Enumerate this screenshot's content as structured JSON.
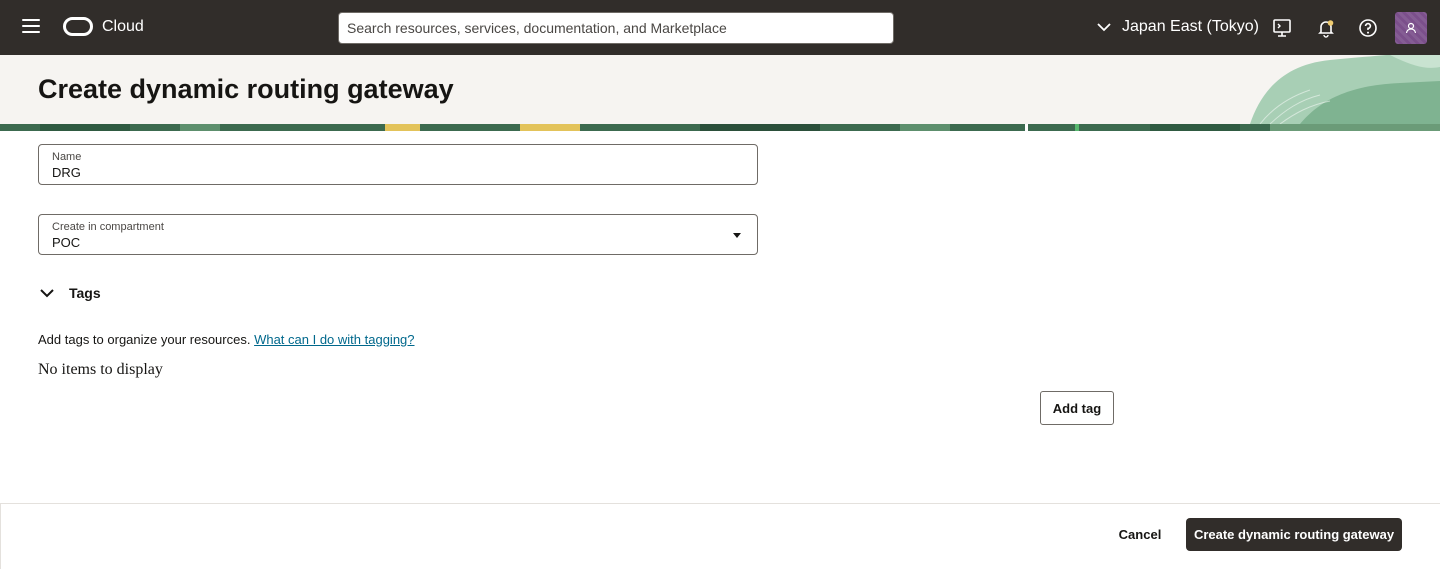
{
  "topbar": {
    "brand": "Cloud",
    "search_placeholder": "Search resources, services, documentation, and Marketplace",
    "region": "Japan East (Tokyo)"
  },
  "page": {
    "title": "Create dynamic routing gateway"
  },
  "form": {
    "name_label": "Name",
    "name_value": "DRG",
    "compartment_label": "Create in compartment",
    "compartment_value": "POC"
  },
  "tags": {
    "section_label": "Tags",
    "description": "Add tags to organize your resources.",
    "help_link": "What can I do with tagging?",
    "empty_text": "No items to display",
    "add_button": "Add tag"
  },
  "footer": {
    "cancel_label": "Cancel",
    "submit_label": "Create dynamic routing gateway"
  },
  "colors": {
    "topbar_bg": "#312d2a",
    "link": "#00688c",
    "primary_button": "#312d2a",
    "avatar": "#7b4f8b"
  }
}
